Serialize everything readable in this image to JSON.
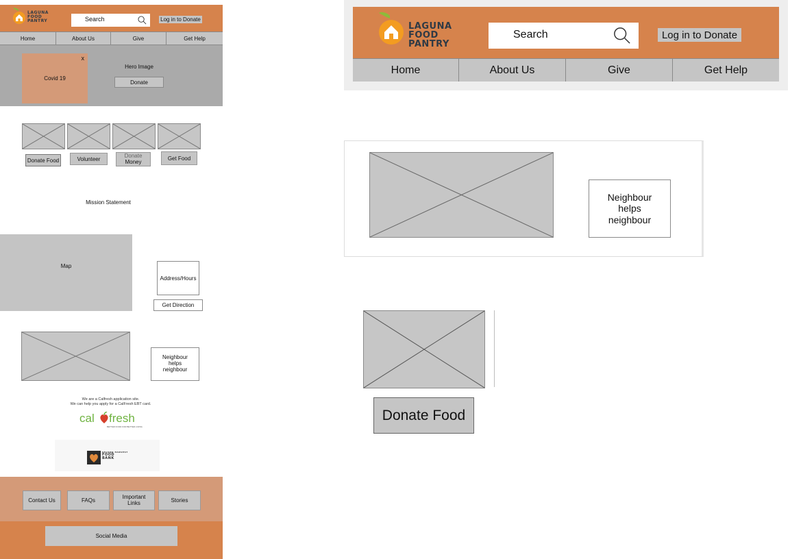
{
  "brand": {
    "line1": "LAGUNA",
    "line2": "FOOD",
    "line3": "PANTRY"
  },
  "header": {
    "search_label": "Search",
    "login_label": "Log in to Donate"
  },
  "nav": {
    "items": [
      {
        "label": "Home"
      },
      {
        "label": "About Us"
      },
      {
        "label": "Give"
      },
      {
        "label": "Get Help"
      }
    ]
  },
  "hero": {
    "covid_label": "Covid 19",
    "close_label": "x",
    "hero_image_label": "Hero Image",
    "donate_label": "Donate"
  },
  "actions": {
    "items": [
      {
        "label": "Donate Food"
      },
      {
        "label": "Volunteer"
      },
      {
        "label1": "Donate",
        "label2": "Money"
      },
      {
        "label": "Get Food"
      }
    ]
  },
  "mission": {
    "label": "Mission Statement"
  },
  "location": {
    "map_label": "Map",
    "address_label": "Address/Hours",
    "direction_label": "Get Direction"
  },
  "neighbour": {
    "line1": "Neighbour",
    "line2": "helps",
    "line3": "neighbour"
  },
  "calfresh": {
    "line1": "We are a Calfresh application site.",
    "line2": "We can help you apply for a CalFresh EBT card.",
    "logo_left": "cal",
    "logo_right": "fresh",
    "tagline": "BETTER FOOD FOR BETTER LIVING"
  },
  "foodbank": {
    "line1": "SECOND HARVEST",
    "line2": "FOOD",
    "line3": "BANK"
  },
  "footer": {
    "links": [
      {
        "label": "Contact Us"
      },
      {
        "label": "FAQs"
      },
      {
        "label1": "Important",
        "label2": "Links"
      },
      {
        "label": "Stories"
      }
    ],
    "social_label": "Social Media"
  },
  "detail": {
    "donate_food_label": "Donate Food"
  },
  "colors": {
    "accent": "#d6834c",
    "placeholder": "#c6c6c6",
    "hero_bg": "#aaaaaa"
  }
}
